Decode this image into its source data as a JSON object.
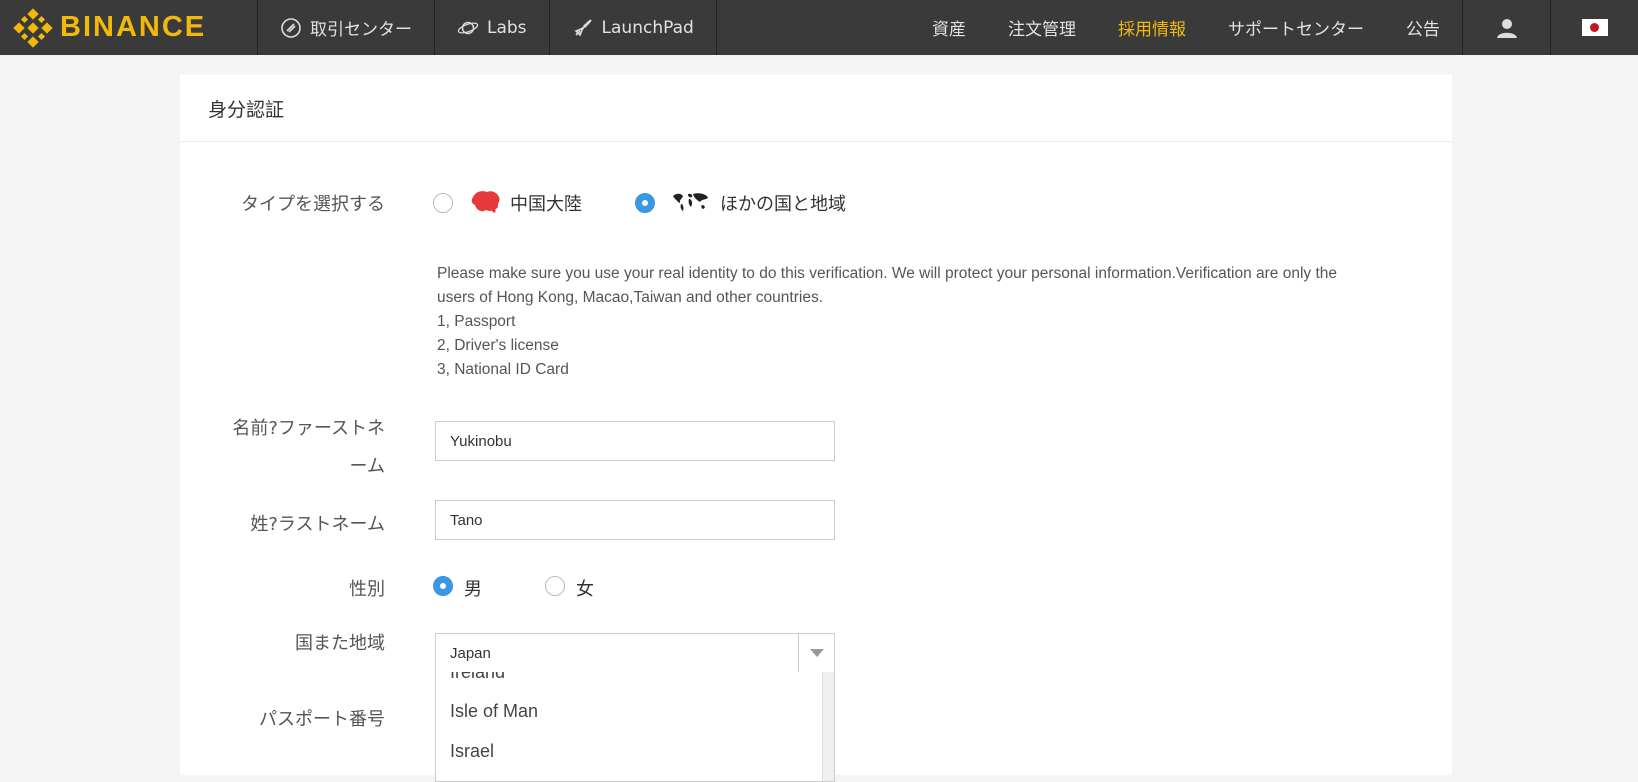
{
  "brand": {
    "name": "BINANCE",
    "color": "#f0b90b"
  },
  "nav": {
    "left": [
      {
        "label": "取引センター",
        "icon": "exchange-icon"
      },
      {
        "label": "Labs",
        "icon": "planet-icon"
      },
      {
        "label": "LaunchPad",
        "icon": "rocket-icon"
      }
    ],
    "right": [
      {
        "label": "資産"
      },
      {
        "label": "注文管理"
      },
      {
        "label": "採用情報",
        "active": true
      },
      {
        "label": "サポートセンター"
      },
      {
        "label": "公告"
      }
    ],
    "user_icon": "user-icon",
    "language_icon": "japan-flag-icon"
  },
  "page": {
    "title": "身分認証",
    "type_label": "タイプを選択する",
    "type_options": [
      {
        "label": "中国大陸",
        "checked": false,
        "icon": "china-map-icon"
      },
      {
        "label": "ほかの国と地域",
        "checked": true,
        "icon": "world-map-icon"
      }
    ],
    "info_lines": [
      "Please make sure you use your real identity to do this verification. We will protect your personal information.Verification are only the",
      "users of Hong Kong, Macao,Taiwan and other countries.",
      "1, Passport",
      "2, Driver's license",
      "3, National ID Card"
    ],
    "first_name_label_line1": "名前?ファーストネ",
    "first_name_label_line2": "ーム",
    "first_name_value": "Yukinobu",
    "last_name_label": "姓?ラストネーム",
    "last_name_value": "Tano",
    "gender_label": "性別",
    "gender_options": [
      {
        "label": "男",
        "checked": true
      },
      {
        "label": "女",
        "checked": false
      }
    ],
    "country_label": "国また地域",
    "country_value": "Japan",
    "country_dropdown_items": [
      "Ireland",
      "Isle of Man",
      "Israel"
    ],
    "passport_label": "パスポート番号",
    "accent_color": "#3b97e3"
  }
}
